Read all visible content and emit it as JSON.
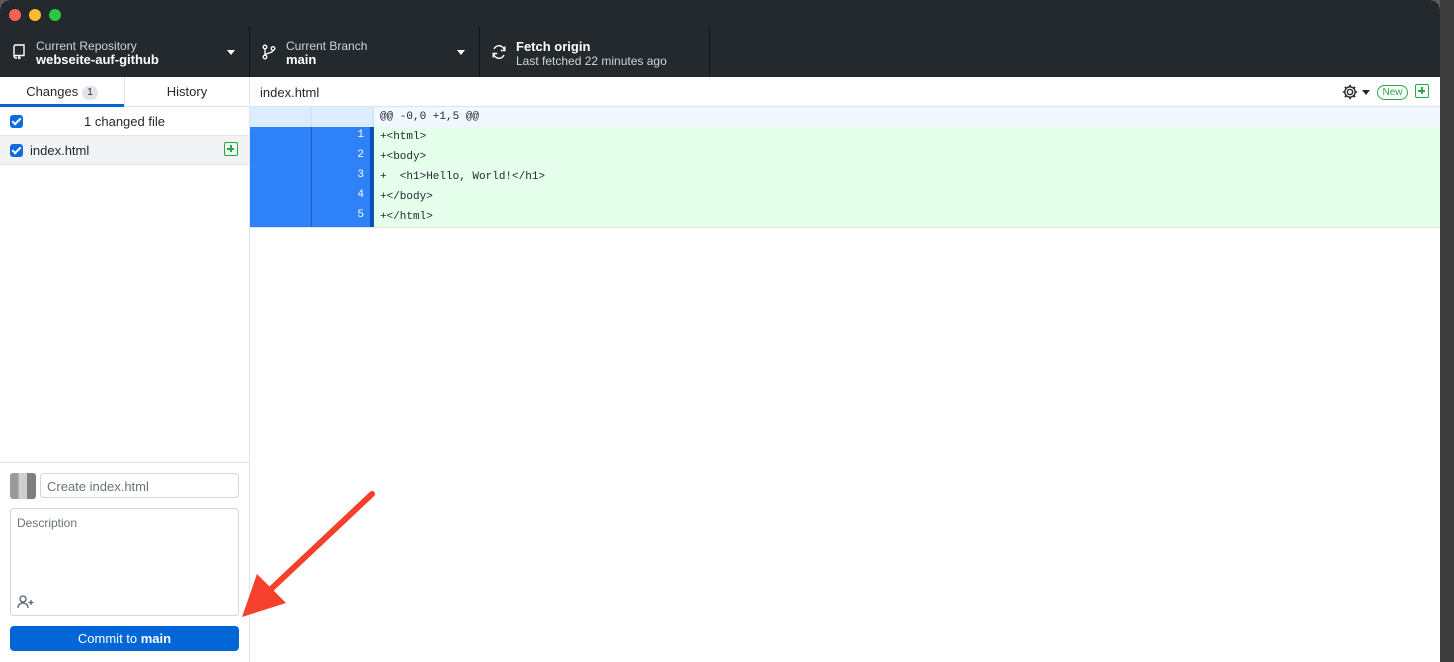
{
  "toolbar": {
    "repo_label": "Current Repository",
    "repo_name": "webseite-auf-github",
    "branch_label": "Current Branch",
    "branch_name": "main",
    "fetch_title": "Fetch origin",
    "fetch_sub": "Last fetched 22 minutes ago"
  },
  "sidebar": {
    "tabs": [
      {
        "label": "Changes",
        "count": "1"
      },
      {
        "label": "History"
      }
    ],
    "changed_files_label": "1 changed file",
    "files": [
      {
        "name": "index.html",
        "status": "added"
      }
    ]
  },
  "commit": {
    "summary_placeholder": "Create index.html",
    "description_placeholder": "Description",
    "button_prefix": "Commit to ",
    "button_branch": "main"
  },
  "diff": {
    "file_name": "index.html",
    "new_badge": "New",
    "hunk_header": "@@ -0,0 +1,5 @@",
    "lines": [
      {
        "num": "1",
        "text": "+<html>"
      },
      {
        "num": "2",
        "text": "+<body>"
      },
      {
        "num": "3",
        "text": "+  <h1>Hello, World!</h1>"
      },
      {
        "num": "4",
        "text": "+</body>"
      },
      {
        "num": "5",
        "text": "+</html>"
      }
    ]
  },
  "colors": {
    "accent": "#0366d6",
    "added_green": "#28a745",
    "annotation_arrow": "#f5402c"
  },
  "icons": [
    "repo-icon",
    "branch-icon",
    "sync-icon",
    "gear-icon",
    "add-file-icon",
    "add-coauthor-icon"
  ]
}
